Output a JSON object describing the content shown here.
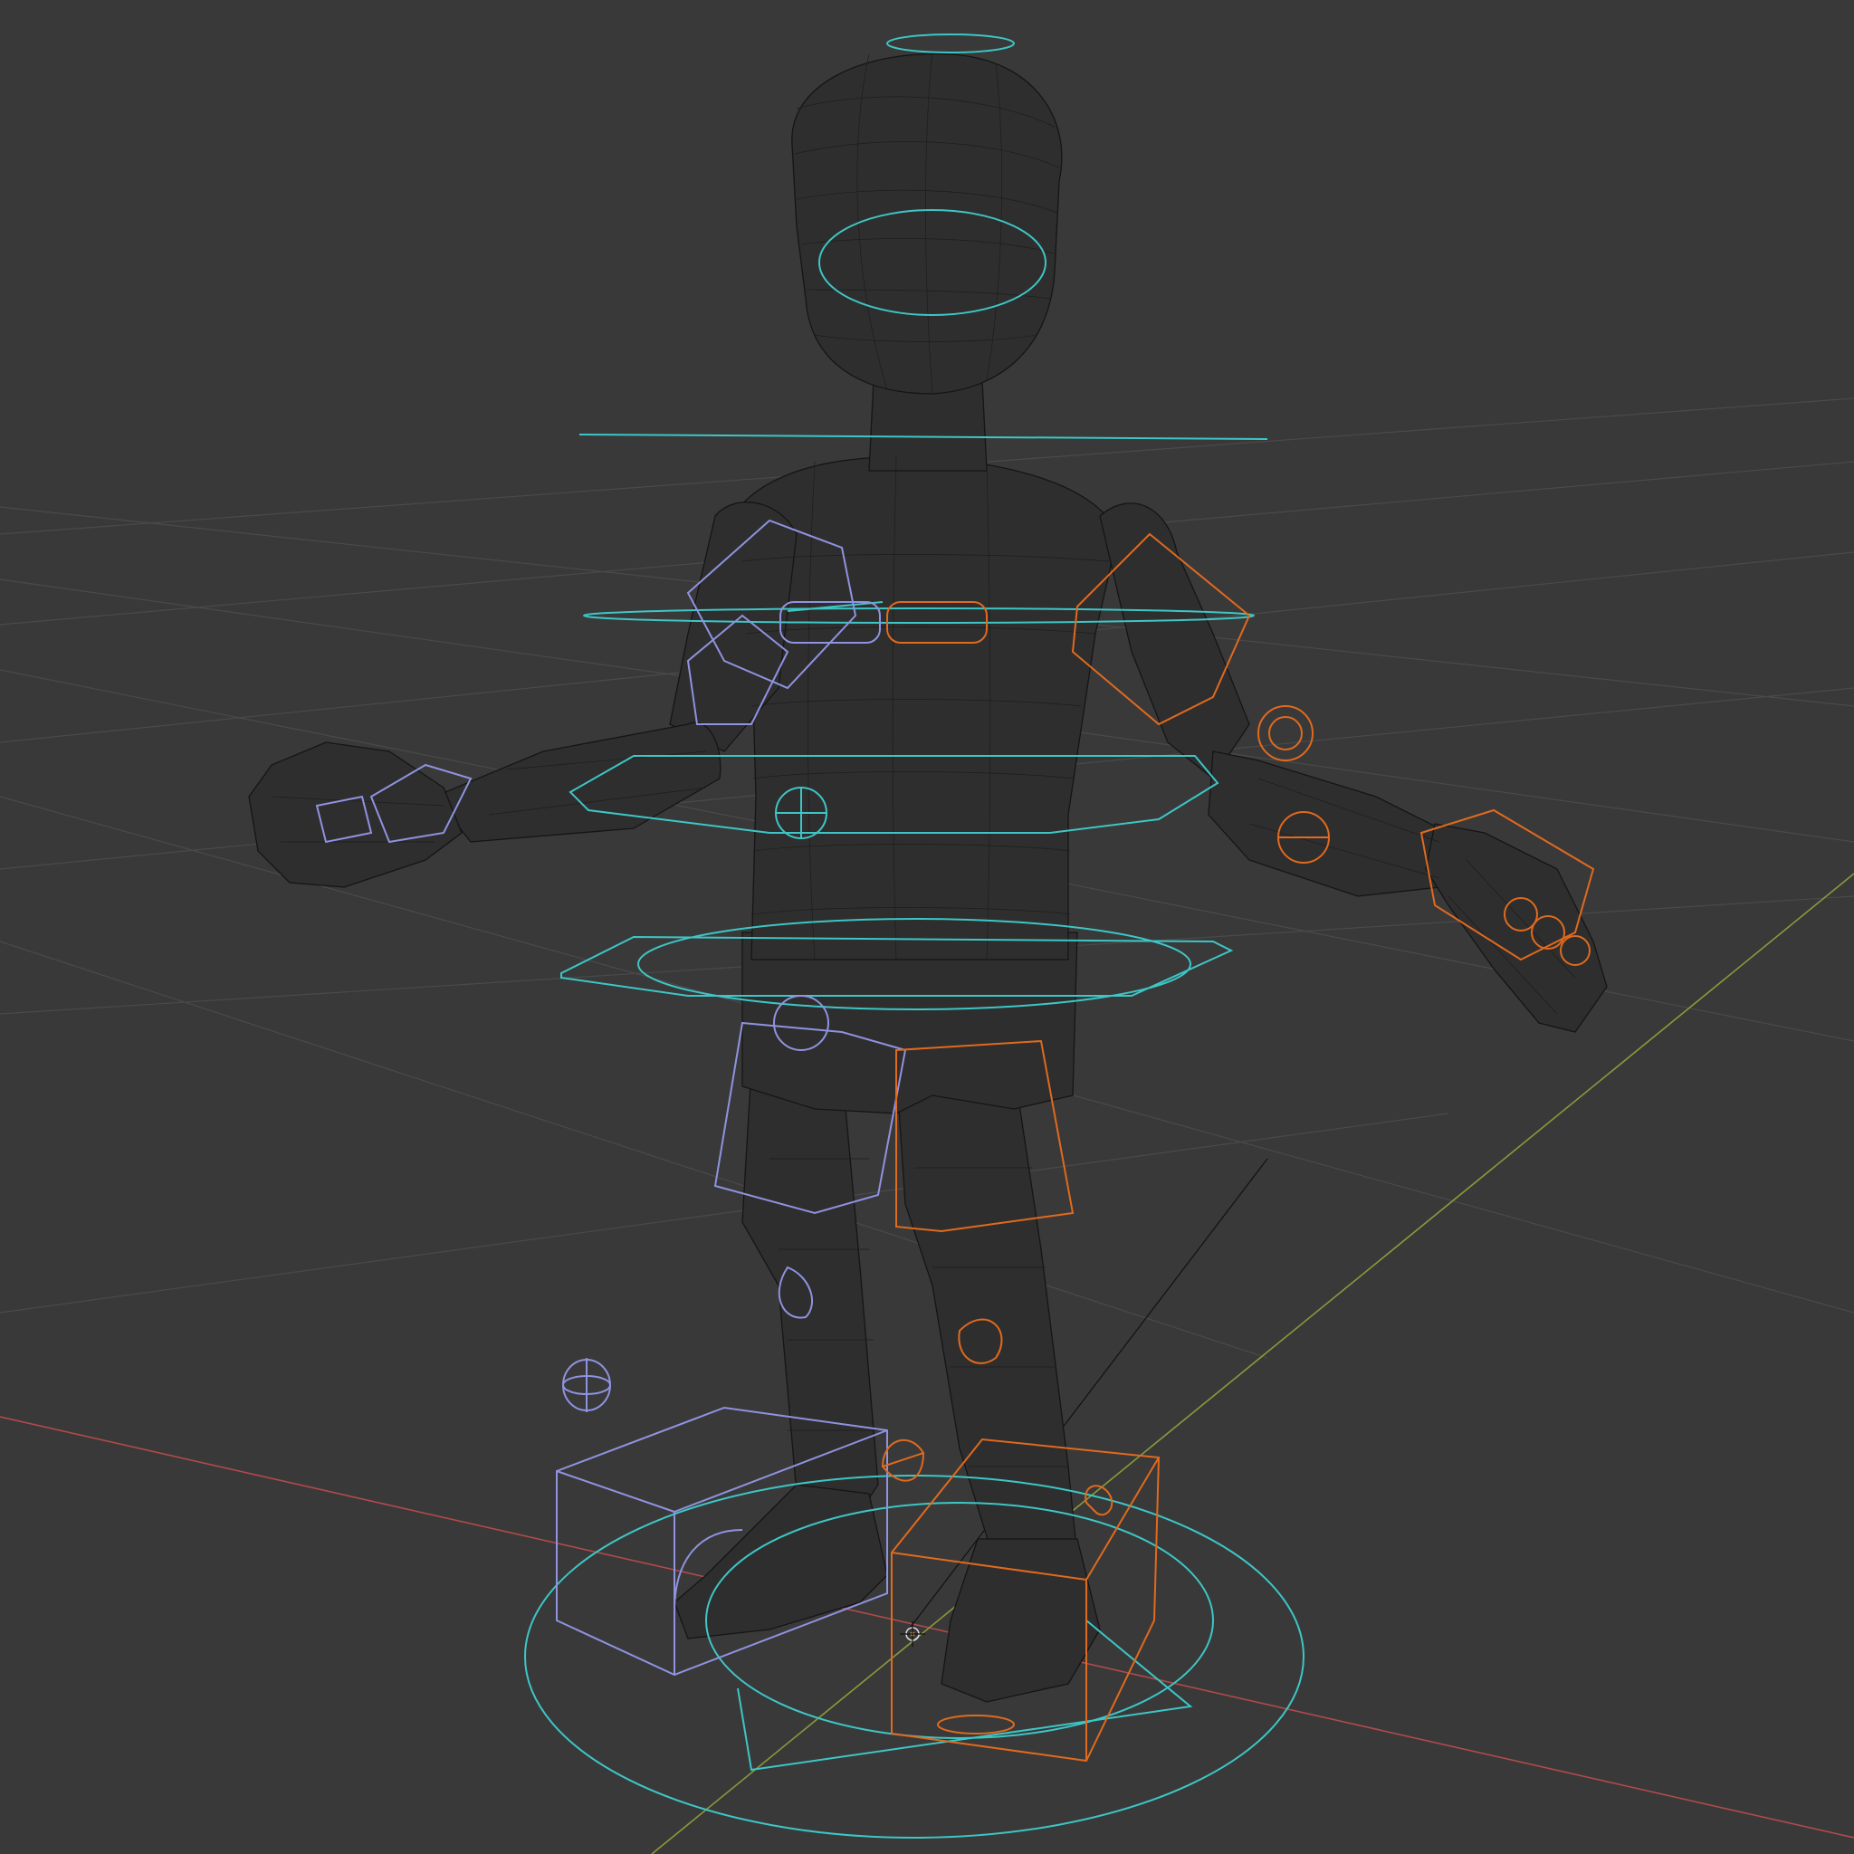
{
  "viewport": {
    "mode": "wireframe",
    "object": "character-rig"
  },
  "colors": {
    "background": "#393939",
    "grid": "#4a4a4a",
    "x_axis": "#b24a4a",
    "y_axis": "#8a9a3a",
    "mesh_wire": "#151515",
    "mesh_fill": "#2e2e2e",
    "center_controls": "#3ec6c6",
    "left_controls": "#8f93e0",
    "right_controls": "#e06a1e"
  },
  "icons": {
    "origin": "3d-cursor-icon"
  }
}
